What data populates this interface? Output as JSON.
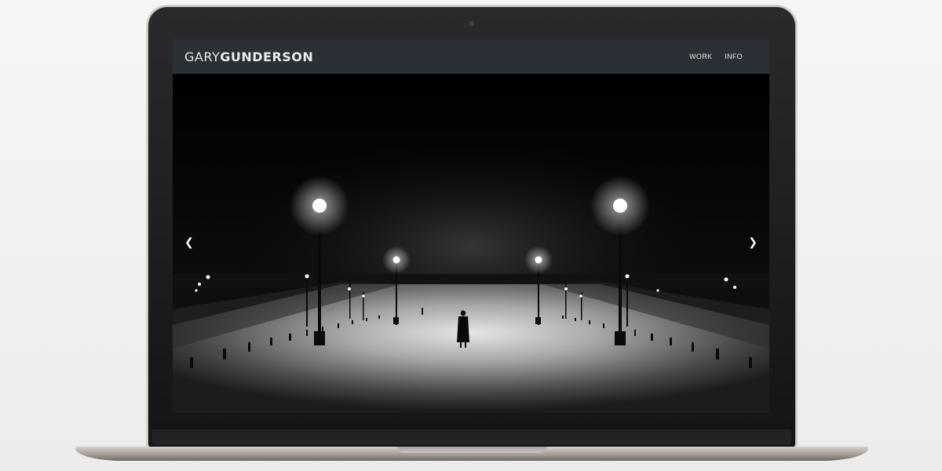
{
  "site": {
    "logo_light": "GARY",
    "logo_bold": "GUNDERSON"
  },
  "nav": {
    "items": [
      {
        "label": "WORK"
      },
      {
        "label": "INFO"
      }
    ]
  },
  "slideshow": {
    "prev_icon": "chevron-left-icon",
    "next_icon": "chevron-right-icon",
    "prev_glyph": "❮",
    "next_glyph": "❯",
    "image": "night-snow-lamp-post-promenade"
  },
  "colors": {
    "header_bg": "#2b2f36",
    "screen_bg": "#060606",
    "text": "#e9ebee"
  }
}
